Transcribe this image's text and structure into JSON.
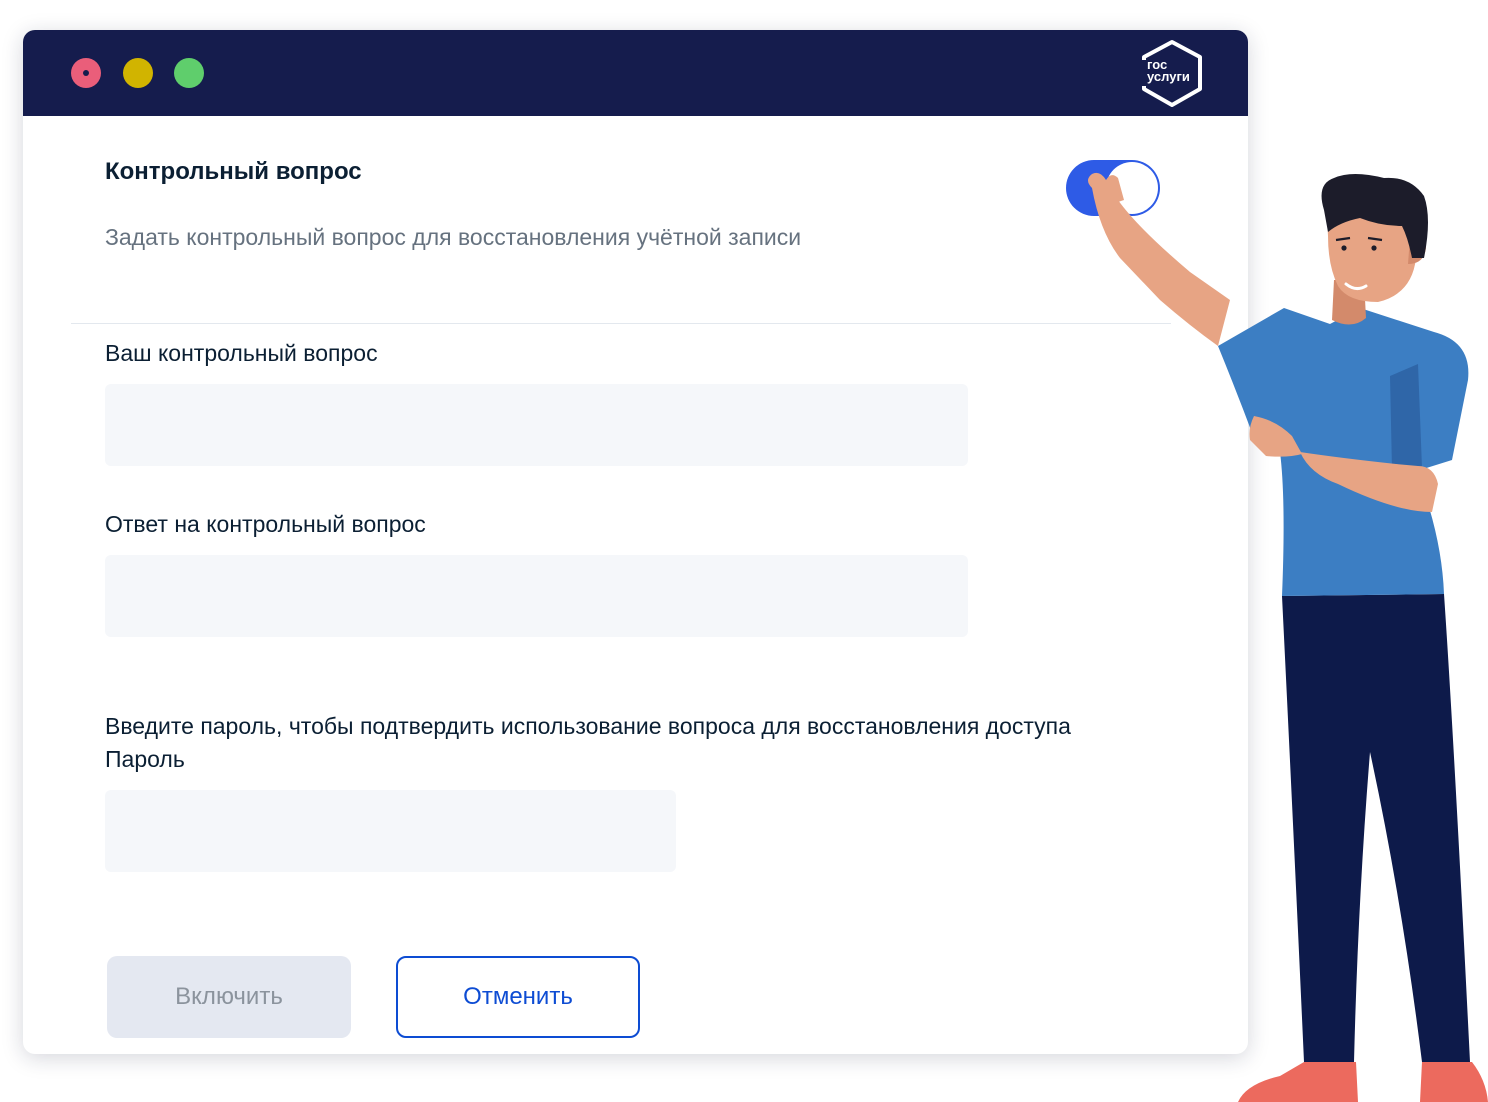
{
  "window": {
    "logo_text": "гос\nуслуги"
  },
  "colors": {
    "titlebar": "#151c4d",
    "dot_red": "#ea5e7a",
    "dot_yellow": "#d1b400",
    "dot_green": "#5fce6c",
    "toggle_on": "#2e5be6",
    "primary_text": "#0b1f33",
    "secondary_text": "#66727f",
    "accent": "#0d4cd3"
  },
  "settings": {
    "title": "Контрольный вопрос",
    "description": "Задать контрольный вопрос для восстановления учётной записи",
    "toggle_on": true
  },
  "form": {
    "question_label": "Ваш контрольный вопрос",
    "question_value": "",
    "answer_label": "Ответ на контрольный вопрос",
    "answer_value": "",
    "confirm_text": "Введите пароль, чтобы подтвердить использование вопроса для восстановления доступа",
    "password_label": "Пароль",
    "password_value": ""
  },
  "buttons": {
    "enable_label": "Включить",
    "cancel_label": "Отменить"
  }
}
